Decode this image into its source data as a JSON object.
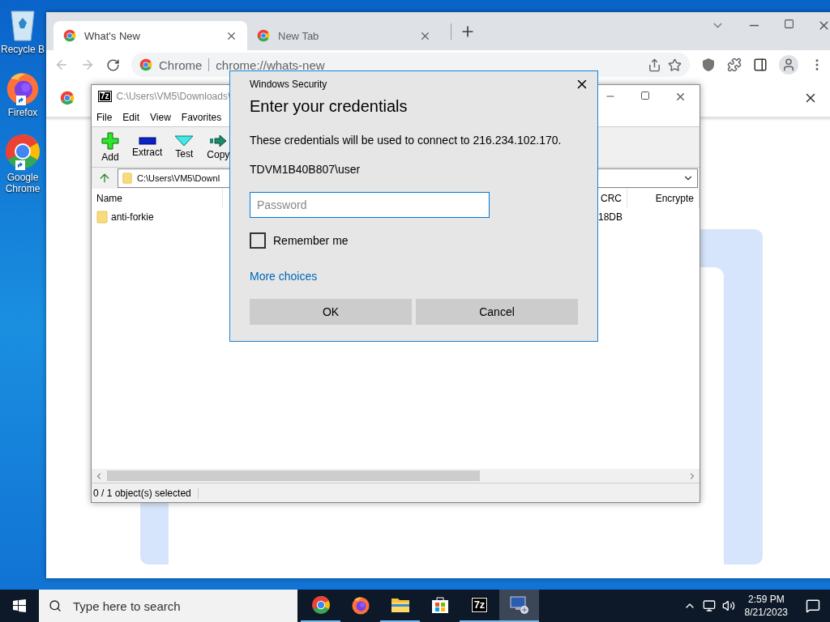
{
  "desktop_icons": [
    {
      "label": "Recycle B",
      "kind": "recycle"
    },
    {
      "label": "Firefox",
      "kind": "firefox"
    },
    {
      "label": "Google Chrome",
      "kind": "chrome"
    }
  ],
  "browser": {
    "tabs": [
      {
        "title": "What's New",
        "selected": true
      },
      {
        "title": "New Tab",
        "selected": false
      }
    ],
    "omnibox": {
      "site": "Chrome",
      "url": "chrome://whats-new"
    }
  },
  "archiver": {
    "logo": "7z",
    "title": "C:\\Users\\VM5\\Downloads\\",
    "menu": [
      "File",
      "Edit",
      "View",
      "Favorites"
    ],
    "tools": [
      {
        "label": "Add",
        "kind": "add"
      },
      {
        "label": "Extract",
        "kind": "extract"
      },
      {
        "label": "Test",
        "kind": "test"
      },
      {
        "label": "Copy",
        "kind": "copy"
      }
    ],
    "address": "C:\\Users\\VM5\\Downl",
    "columns": [
      "Name",
      "CRC",
      "Encrypte"
    ],
    "rows": [
      {
        "name": "anti-forkie",
        "crc": "18DB"
      }
    ],
    "status": "0 / 1 object(s) selected"
  },
  "dialog": {
    "title": "Windows Security",
    "heading": "Enter your credentials",
    "message": "These credentials will be used to connect to 216.234.102.170.",
    "user": "TDVM1B40B807\\user",
    "password": {
      "placeholder": "Password"
    },
    "remember": {
      "label": "Remember me",
      "checked": false
    },
    "link": "More choices",
    "buttons": [
      "OK",
      "Cancel"
    ]
  },
  "taskbar": {
    "search": {
      "placeholder": "Type here to search"
    },
    "apps": [
      {
        "kind": "chrome",
        "running": true,
        "selected": false
      },
      {
        "kind": "firefox",
        "running": false,
        "selected": false
      },
      {
        "kind": "explorer",
        "running": true,
        "selected": false
      },
      {
        "kind": "store",
        "running": false,
        "selected": false
      },
      {
        "kind": "archiver",
        "label": "7z",
        "running": true,
        "selected": false
      },
      {
        "kind": "remote",
        "running": true,
        "selected": true
      }
    ],
    "time": "2:59 PM",
    "date": "8/21/2023"
  }
}
